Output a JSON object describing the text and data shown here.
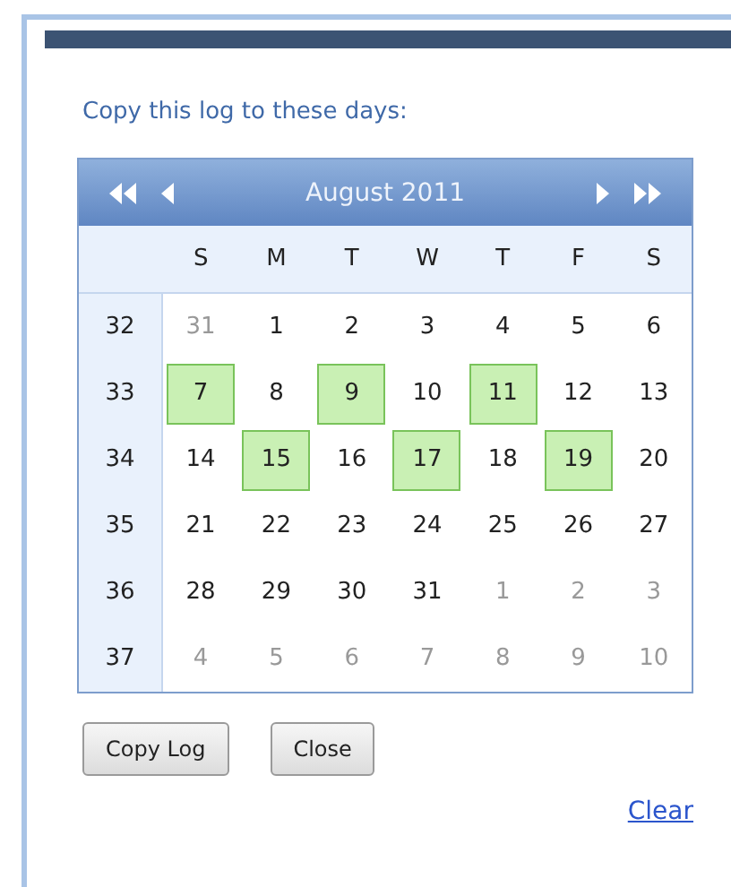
{
  "prompt": "Copy this log to these days:",
  "calendar": {
    "month": "August 2011",
    "weekdays": [
      "S",
      "M",
      "T",
      "W",
      "T",
      "F",
      "S"
    ],
    "weeks": [
      {
        "number": "32",
        "days": [
          {
            "day": "31",
            "other_month": true,
            "selected": false
          },
          {
            "day": "1",
            "other_month": false,
            "selected": false
          },
          {
            "day": "2",
            "other_month": false,
            "selected": false
          },
          {
            "day": "3",
            "other_month": false,
            "selected": false
          },
          {
            "day": "4",
            "other_month": false,
            "selected": false
          },
          {
            "day": "5",
            "other_month": false,
            "selected": false
          },
          {
            "day": "6",
            "other_month": false,
            "selected": false
          }
        ]
      },
      {
        "number": "33",
        "days": [
          {
            "day": "7",
            "other_month": false,
            "selected": true
          },
          {
            "day": "8",
            "other_month": false,
            "selected": false
          },
          {
            "day": "9",
            "other_month": false,
            "selected": true
          },
          {
            "day": "10",
            "other_month": false,
            "selected": false
          },
          {
            "day": "11",
            "other_month": false,
            "selected": true
          },
          {
            "day": "12",
            "other_month": false,
            "selected": false
          },
          {
            "day": "13",
            "other_month": false,
            "selected": false
          }
        ]
      },
      {
        "number": "34",
        "days": [
          {
            "day": "14",
            "other_month": false,
            "selected": false
          },
          {
            "day": "15",
            "other_month": false,
            "selected": true
          },
          {
            "day": "16",
            "other_month": false,
            "selected": false
          },
          {
            "day": "17",
            "other_month": false,
            "selected": true
          },
          {
            "day": "18",
            "other_month": false,
            "selected": false
          },
          {
            "day": "19",
            "other_month": false,
            "selected": true
          },
          {
            "day": "20",
            "other_month": false,
            "selected": false
          }
        ]
      },
      {
        "number": "35",
        "days": [
          {
            "day": "21",
            "other_month": false,
            "selected": false
          },
          {
            "day": "22",
            "other_month": false,
            "selected": false
          },
          {
            "day": "23",
            "other_month": false,
            "selected": false
          },
          {
            "day": "24",
            "other_month": false,
            "selected": false
          },
          {
            "day": "25",
            "other_month": false,
            "selected": false
          },
          {
            "day": "26",
            "other_month": false,
            "selected": false
          },
          {
            "day": "27",
            "other_month": false,
            "selected": false
          }
        ]
      },
      {
        "number": "36",
        "days": [
          {
            "day": "28",
            "other_month": false,
            "selected": false
          },
          {
            "day": "29",
            "other_month": false,
            "selected": false
          },
          {
            "day": "30",
            "other_month": false,
            "selected": false
          },
          {
            "day": "31",
            "other_month": false,
            "selected": false
          },
          {
            "day": "1",
            "other_month": true,
            "selected": false
          },
          {
            "day": "2",
            "other_month": true,
            "selected": false
          },
          {
            "day": "3",
            "other_month": true,
            "selected": false
          }
        ]
      },
      {
        "number": "37",
        "days": [
          {
            "day": "4",
            "other_month": true,
            "selected": false
          },
          {
            "day": "5",
            "other_month": true,
            "selected": false
          },
          {
            "day": "6",
            "other_month": true,
            "selected": false
          },
          {
            "day": "7",
            "other_month": true,
            "selected": false
          },
          {
            "day": "8",
            "other_month": true,
            "selected": false
          },
          {
            "day": "9",
            "other_month": true,
            "selected": false
          },
          {
            "day": "10",
            "other_month": true,
            "selected": false
          }
        ]
      }
    ]
  },
  "buttons": [
    "Copy Log",
    "Close"
  ],
  "clear_link": "Clear"
}
